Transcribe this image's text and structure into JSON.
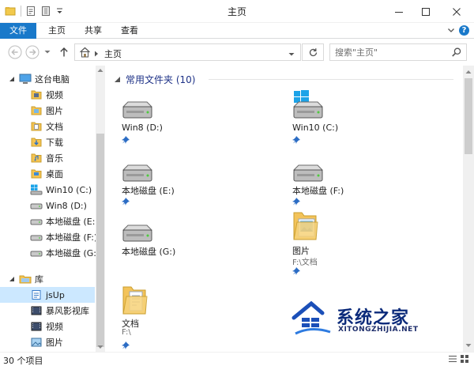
{
  "window": {
    "title": "主页",
    "controls": {
      "minimize_icon": "minimize-icon",
      "maximize_icon": "maximize-icon",
      "close_icon": "close-icon"
    }
  },
  "ribbon": {
    "tabs": [
      {
        "label": "文件",
        "active": true
      },
      {
        "label": "主页"
      },
      {
        "label": "共享"
      },
      {
        "label": "查看"
      }
    ],
    "accent_color": "#1979ca",
    "help": "?"
  },
  "addressbar": {
    "path": [
      "主页"
    ],
    "search_placeholder": "搜索\"主页\""
  },
  "navigation": {
    "items": [
      {
        "label": "这台电脑",
        "icon": "pc-icon",
        "level": 0,
        "expanded": true
      },
      {
        "label": "视频",
        "icon": "video-folder-icon",
        "level": 1
      },
      {
        "label": "图片",
        "icon": "pictures-folder-icon",
        "level": 1
      },
      {
        "label": "文档",
        "icon": "documents-folder-icon",
        "level": 1
      },
      {
        "label": "下载",
        "icon": "downloads-folder-icon",
        "level": 1
      },
      {
        "label": "音乐",
        "icon": "music-folder-icon",
        "level": 1
      },
      {
        "label": "桌面",
        "icon": "desktop-folder-icon",
        "level": 1
      },
      {
        "label": "Win10 (C:)",
        "icon": "windows-drive-icon",
        "level": 1
      },
      {
        "label": "Win8 (D:)",
        "icon": "drive-icon",
        "level": 1
      },
      {
        "label": "本地磁盘 (E:)",
        "icon": "drive-icon",
        "level": 1
      },
      {
        "label": "本地磁盘 (F:)",
        "icon": "drive-icon",
        "level": 1
      },
      {
        "label": "本地磁盘 (G:)",
        "icon": "drive-icon",
        "level": 1
      },
      {
        "label": "库",
        "icon": "library-icon",
        "level": 0,
        "expanded": true
      },
      {
        "label": "jsUp",
        "icon": "library-item-icon",
        "level": 1,
        "selected": true
      },
      {
        "label": "暴风影视库",
        "icon": "video-library-icon",
        "level": 1
      },
      {
        "label": "视频",
        "icon": "video-library-icon",
        "level": 1
      },
      {
        "label": "图片",
        "icon": "pictures-library-icon",
        "level": 1
      }
    ]
  },
  "content": {
    "group_title": "常用文件夹 (10)",
    "tiles": [
      {
        "name": "Win8 (D:)",
        "sub": "",
        "icon": "drive-icon",
        "pinned": true
      },
      {
        "name": "Win10 (C:)",
        "sub": "",
        "icon": "windows-drive-icon",
        "pinned": true
      },
      {
        "name": "本地磁盘 (E:)",
        "sub": "",
        "icon": "drive-icon",
        "pinned": true
      },
      {
        "name": "本地磁盘 (F:)",
        "sub": "",
        "icon": "drive-icon",
        "pinned": true
      },
      {
        "name": "本地磁盘 (G:)",
        "sub": "",
        "icon": "drive-icon",
        "pinned": false
      },
      {
        "name": "图片",
        "sub": "F:\\文档",
        "icon": "pictures-folder-icon",
        "pinned": true
      },
      {
        "name": "文档",
        "sub": "F:\\",
        "icon": "documents-folder-icon",
        "pinned": true
      }
    ]
  },
  "statusbar": {
    "item_count": "30 个项目"
  },
  "watermark": {
    "text": "系统之家",
    "url": "XITONGZHIJIA.NET"
  }
}
